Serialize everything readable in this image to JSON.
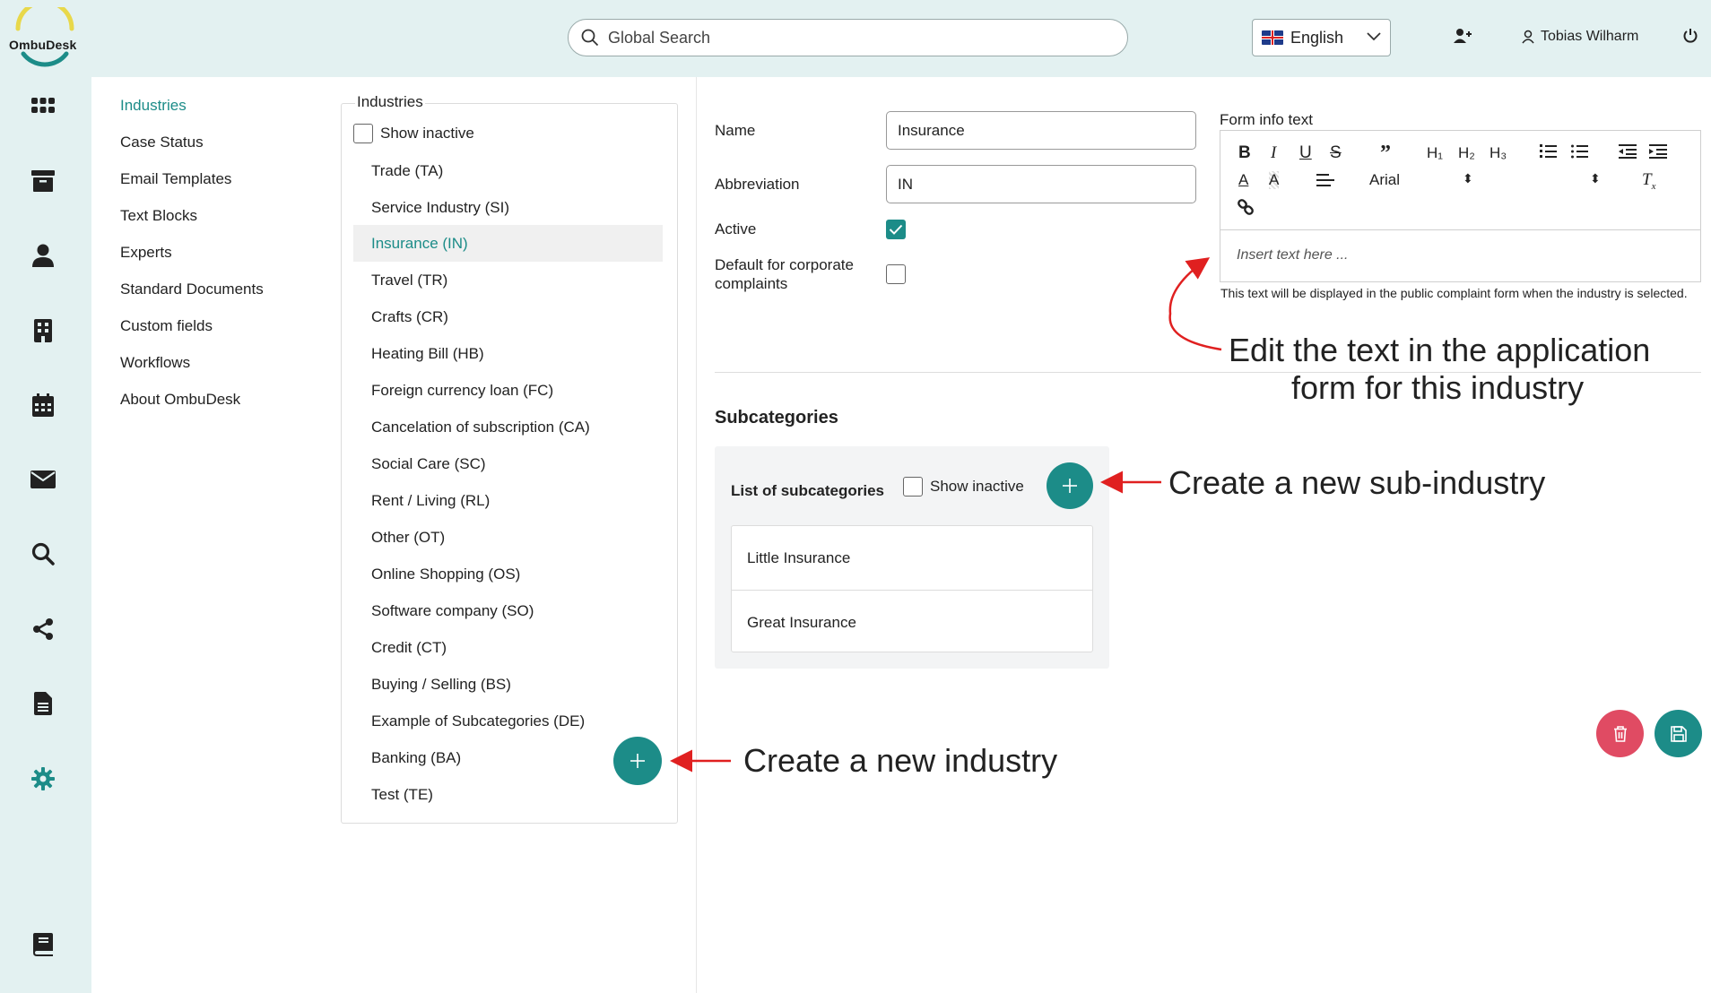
{
  "header": {
    "logo_text": "OmbuDesk",
    "search_placeholder": "Global Search",
    "language": "English",
    "user_name": "Tobias Wilharm"
  },
  "settings_nav": {
    "items": [
      "Industries",
      "Case Status",
      "Email Templates",
      "Text Blocks",
      "Experts",
      "Standard Documents",
      "Custom fields",
      "Workflows",
      "About OmbuDesk"
    ]
  },
  "industries": {
    "title": "Industries",
    "show_inactive_label": "Show inactive",
    "items": [
      "Trade (TA)",
      "Service Industry (SI)",
      "Insurance (IN)",
      "Travel (TR)",
      "Crafts (CR)",
      "Heating Bill (HB)",
      "Foreign currency loan (FC)",
      "Cancelation of subscription (CA)",
      "Social Care (SC)",
      "Rent / Living (RL)",
      "Other (OT)",
      "Online Shopping (OS)",
      "Software company (SO)",
      "Credit (CT)",
      "Buying / Selling (BS)",
      "Example of Subcategories (DE)",
      "Banking (BA)",
      "Test (TE)"
    ],
    "selected": "Insurance (IN)"
  },
  "form": {
    "name_label": "Name",
    "name_value": "Insurance",
    "abbreviation_label": "Abbreviation",
    "abbreviation_value": "IN",
    "active_label": "Active",
    "active_checked": true,
    "default_label": "Default for corporate complaints",
    "default_checked": false,
    "form_info_label": "Form info text",
    "editor_font": "Arial",
    "editor_placeholder": "Insert text here ...",
    "hint": "This text will be displayed in the public complaint form when the industry is selected."
  },
  "subcategories": {
    "title": "Subcategories",
    "list_label": "List of subcategories",
    "show_inactive_label": "Show inactive",
    "items": [
      "Little Insurance",
      "Great Insurance"
    ]
  },
  "annotations": {
    "edit_text_line1": "Edit the text in the application",
    "edit_text_line2": "form for this industry",
    "new_sub": "Create a new sub-industry",
    "new_industry": "Create a new industry"
  },
  "colors": {
    "accent": "#1c8c88",
    "rail_bg": "#e3f1f1",
    "delete": "#e04b63",
    "annotation_arrow": "#e02020"
  }
}
